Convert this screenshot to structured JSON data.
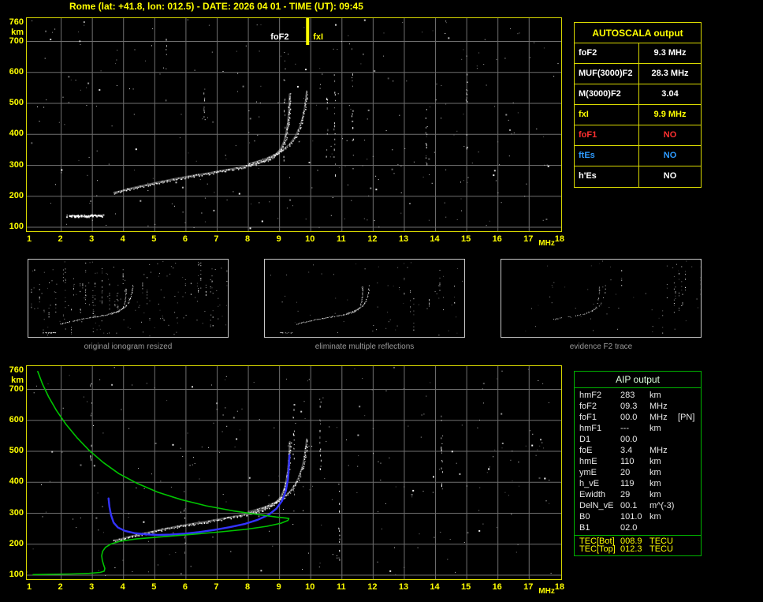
{
  "header": {
    "title": "Rome (lat: +41.8, lon: 012.5) - DATE: 2026 04 01 - TIME (UT): 09:45"
  },
  "autoscala": {
    "title": "AUTOSCALA output",
    "rows": [
      {
        "label": "foF2",
        "value": "9.3 MHz",
        "color": "#ffffff"
      },
      {
        "label": "MUF(3000)F2",
        "value": "28.3 MHz",
        "color": "#ffffff"
      },
      {
        "label": "M(3000)F2",
        "value": "3.04",
        "color": "#ffffff"
      },
      {
        "label": "fxI",
        "value": "9.9 MHz",
        "color": "#ffff00"
      },
      {
        "label": "foF1",
        "value": "NO",
        "color": "#ff3030"
      },
      {
        "label": "ftEs",
        "value": "NO",
        "color": "#2e9bff"
      },
      {
        "label": "h'Es",
        "value": "NO",
        "color": "#ffffff"
      }
    ]
  },
  "aip": {
    "title": "AIP output",
    "rows": [
      {
        "label": "hmF2",
        "value": "283",
        "unit": "km",
        "extra": ""
      },
      {
        "label": "foF2",
        "value": "09.3",
        "unit": "MHz",
        "extra": ""
      },
      {
        "label": "foF1",
        "value": "00.0",
        "unit": "MHz",
        "extra": "[PN]"
      },
      {
        "label": "hmF1",
        "value": "---",
        "unit": "km",
        "extra": ""
      },
      {
        "label": "D1",
        "value": "00.0",
        "unit": "",
        "extra": ""
      },
      {
        "label": "foE",
        "value": "3.4",
        "unit": "MHz",
        "extra": ""
      },
      {
        "label": "hmE",
        "value": "110",
        "unit": "km",
        "extra": ""
      },
      {
        "label": "ymE",
        "value": "20",
        "unit": "km",
        "extra": ""
      },
      {
        "label": "h_vE",
        "value": "119",
        "unit": "km",
        "extra": ""
      },
      {
        "label": "Ewidth",
        "value": "29",
        "unit": "km",
        "extra": ""
      },
      {
        "label": "DelN_vE",
        "value": "00.1",
        "unit": "m^(-3)",
        "extra": ""
      },
      {
        "label": "B0",
        "value": "101.0",
        "unit": "km",
        "extra": ""
      },
      {
        "label": "B1",
        "value": "02.0",
        "unit": "",
        "extra": ""
      }
    ],
    "tec_rows": [
      {
        "label": "TEC[Bot]",
        "value": "008.9",
        "unit": "TECU"
      },
      {
        "label": "TEC[Top]",
        "value": "012.3",
        "unit": "TECU"
      }
    ]
  },
  "thumbnails": [
    {
      "caption": "original ionogram resized"
    },
    {
      "caption": "eliminate multiple reflections"
    },
    {
      "caption": "evidence F2 trace"
    }
  ],
  "ionogram_axes": {
    "y_ticks": [
      760,
      700,
      600,
      500,
      400,
      300,
      200,
      100
    ],
    "y_unit": "km",
    "x_ticks": [
      1,
      2,
      3,
      4,
      5,
      6,
      7,
      8,
      9,
      10,
      11,
      12,
      13,
      14,
      15,
      16,
      17,
      18
    ],
    "x_unit": "MHz",
    "x_range": [
      1,
      18
    ],
    "y_range": [
      100,
      760
    ]
  },
  "top_plot_labels": {
    "fof2": "foF2",
    "fxi": "fxI",
    "fof2_freq": 9.3,
    "fxi_freq": 9.9
  },
  "chart_data": [
    {
      "type": "scatter",
      "title": "measured ionogram (top panel)",
      "xlabel": "MHz",
      "ylabel": "km",
      "xlim": [
        1,
        18
      ],
      "ylim": [
        100,
        760
      ],
      "grid": true,
      "series": [
        {
          "name": "F2 ordinary trace",
          "color": "#ffffff",
          "points": [
            [
              3.7,
              212
            ],
            [
              3.9,
              216
            ],
            [
              4.1,
              222
            ],
            [
              4.4,
              229
            ],
            [
              4.8,
              238
            ],
            [
              5.2,
              247
            ],
            [
              5.7,
              257
            ],
            [
              6.2,
              266
            ],
            [
              6.7,
              274
            ],
            [
              7.2,
              283
            ],
            [
              7.7,
              292
            ],
            [
              8.1,
              301
            ],
            [
              8.45,
              311
            ],
            [
              8.7,
              322
            ],
            [
              8.9,
              336
            ],
            [
              9.05,
              354
            ],
            [
              9.15,
              377
            ],
            [
              9.22,
              404
            ],
            [
              9.27,
              436
            ],
            [
              9.3,
              470
            ],
            [
              9.32,
              503
            ],
            [
              9.33,
              530
            ]
          ]
        },
        {
          "name": "F2 extraordinary trace",
          "color": "#ffffff",
          "points": [
            [
              8.0,
              305
            ],
            [
              8.3,
              313
            ],
            [
              8.6,
              323
            ],
            [
              8.85,
              335
            ],
            [
              9.1,
              350
            ],
            [
              9.32,
              368
            ],
            [
              9.5,
              392
            ],
            [
              9.63,
              420
            ],
            [
              9.73,
              450
            ],
            [
              9.8,
              482
            ],
            [
              9.84,
              512
            ],
            [
              9.87,
              540
            ]
          ]
        },
        {
          "name": "low E-region echo",
          "color": "#ffffff",
          "points": [
            [
              2.2,
              139
            ],
            [
              2.5,
              138
            ],
            [
              2.9,
              138
            ],
            [
              3.3,
              139
            ]
          ]
        }
      ],
      "annotations": [
        {
          "text": "foF2",
          "x": 9.3,
          "color": "#ffffff"
        },
        {
          "text": "fxI",
          "x": 9.9,
          "color": "#ffff00",
          "marker": "vertical-line"
        }
      ]
    },
    {
      "type": "line",
      "title": "AIP inversion (bottom panel)",
      "xlabel": "MHz",
      "ylabel": "km",
      "xlim": [
        1,
        18
      ],
      "ylim": [
        100,
        760
      ],
      "grid": true,
      "series": [
        {
          "name": "electron density profile",
          "color": "#00c400",
          "points": [
            [
              1.25,
              758
            ],
            [
              1.4,
              718
            ],
            [
              1.6,
              676
            ],
            [
              1.85,
              632
            ],
            [
              2.15,
              588
            ],
            [
              2.5,
              545
            ],
            [
              2.9,
              503
            ],
            [
              3.35,
              464
            ],
            [
              3.85,
              428
            ],
            [
              4.45,
              396
            ],
            [
              5.1,
              368
            ],
            [
              5.85,
              344
            ],
            [
              6.65,
              324
            ],
            [
              7.5,
              308
            ],
            [
              8.3,
              296
            ],
            [
              8.9,
              288
            ],
            [
              9.2,
              284.5
            ],
            [
              9.3,
              283
            ],
            [
              9.27,
              277
            ],
            [
              9.05,
              268
            ],
            [
              8.6,
              258
            ],
            [
              7.9,
              248
            ],
            [
              7.0,
              239
            ],
            [
              6.1,
              231
            ],
            [
              5.2,
              224
            ],
            [
              4.4,
              217
            ],
            [
              3.9,
              210
            ],
            [
              3.6,
              201
            ],
            [
              3.42,
              190
            ],
            [
              3.33,
              177
            ],
            [
              3.3,
              163
            ],
            [
              3.32,
              148
            ],
            [
              3.36,
              134
            ],
            [
              3.4,
              122
            ],
            [
              3.38,
              113
            ],
            [
              3.25,
              109
            ],
            [
              2.9,
              106
            ],
            [
              2.3,
              104
            ],
            [
              1.6,
              103
            ],
            [
              1.1,
              102
            ]
          ]
        },
        {
          "name": "reconstructed trace",
          "color": "#3333ff",
          "points": [
            [
              3.52,
              348
            ],
            [
              3.55,
              320
            ],
            [
              3.6,
              294
            ],
            [
              3.68,
              270
            ],
            [
              3.82,
              254
            ],
            [
              4.05,
              243
            ],
            [
              4.35,
              236
            ],
            [
              4.7,
              232
            ],
            [
              5.1,
              230
            ],
            [
              5.5,
              231
            ],
            [
              5.95,
              234
            ],
            [
              6.4,
              239
            ],
            [
              6.9,
              246
            ],
            [
              7.4,
              255
            ],
            [
              7.9,
              266
            ],
            [
              8.3,
              279
            ],
            [
              8.65,
              295
            ],
            [
              8.9,
              315
            ],
            [
              9.08,
              340
            ],
            [
              9.2,
              372
            ],
            [
              9.27,
              410
            ],
            [
              9.3,
              450
            ],
            [
              9.32,
              488
            ]
          ]
        },
        {
          "name": "measured F2 ordinary trace",
          "color": "#ffffff",
          "points": [
            [
              3.7,
              212
            ],
            [
              3.9,
              216
            ],
            [
              4.1,
              222
            ],
            [
              4.4,
              229
            ],
            [
              4.8,
              238
            ],
            [
              5.2,
              247
            ],
            [
              5.7,
              257
            ],
            [
              6.2,
              266
            ],
            [
              6.7,
              274
            ],
            [
              7.2,
              283
            ],
            [
              7.7,
              292
            ],
            [
              8.1,
              301
            ],
            [
              8.45,
              311
            ],
            [
              8.7,
              322
            ],
            [
              8.9,
              336
            ],
            [
              9.05,
              354
            ],
            [
              9.15,
              377
            ],
            [
              9.22,
              404
            ],
            [
              9.27,
              436
            ],
            [
              9.3,
              470
            ],
            [
              9.32,
              503
            ],
            [
              9.33,
              530
            ]
          ]
        },
        {
          "name": "measured F2 extraordinary trace",
          "color": "#ffffff",
          "points": [
            [
              8.0,
              305
            ],
            [
              8.3,
              313
            ],
            [
              8.6,
              323
            ],
            [
              8.85,
              335
            ],
            [
              9.1,
              350
            ],
            [
              9.32,
              368
            ],
            [
              9.5,
              392
            ],
            [
              9.63,
              420
            ],
            [
              9.73,
              450
            ],
            [
              9.8,
              482
            ],
            [
              9.84,
              512
            ],
            [
              9.87,
              540
            ]
          ]
        }
      ]
    }
  ],
  "render_hints": {
    "noise_seed_top": 20260401,
    "noise_seed_bottom": 945,
    "noise_seed_thumbs": [
      101,
      202,
      303
    ],
    "grid_color": "#6f6f6f",
    "frame_color": "#d8d800",
    "axis_text_color": "#ffff00"
  }
}
